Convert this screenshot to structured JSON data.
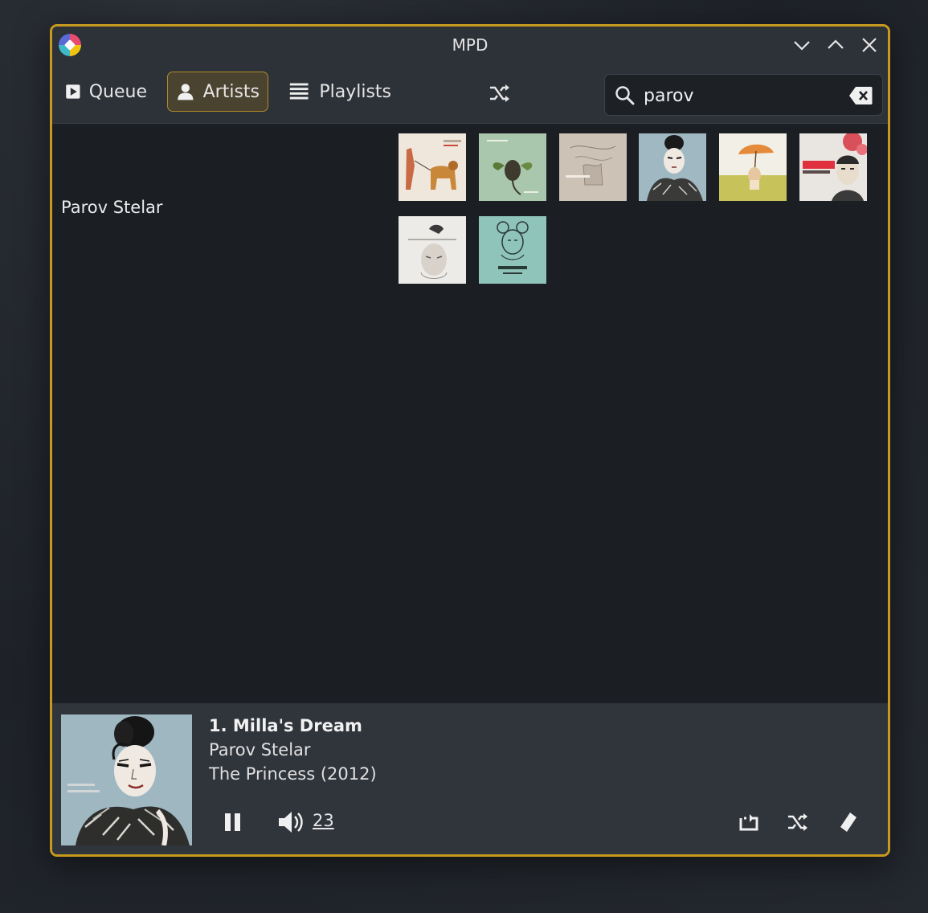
{
  "window": {
    "title": "MPD",
    "accent": "#c79a1e"
  },
  "toolbar": {
    "tabs": [
      {
        "label": "Queue",
        "icon": "play-icon",
        "active": false
      },
      {
        "label": "Artists",
        "icon": "person-icon",
        "active": true
      },
      {
        "label": "Playlists",
        "icon": "list-icon",
        "active": false
      }
    ],
    "shuffle_icon": "shuffle-icon",
    "search": {
      "value": "parov",
      "placeholder": "",
      "clear_icon": "backspace-icon"
    }
  },
  "artists": {
    "items": [
      "Parov Stelar"
    ]
  },
  "albums": {
    "count": 8
  },
  "now_playing": {
    "title": "1. Milla's Dream",
    "artist": "Parov Stelar",
    "album": "The Princess (2012)",
    "volume": "23",
    "state": "playing"
  }
}
